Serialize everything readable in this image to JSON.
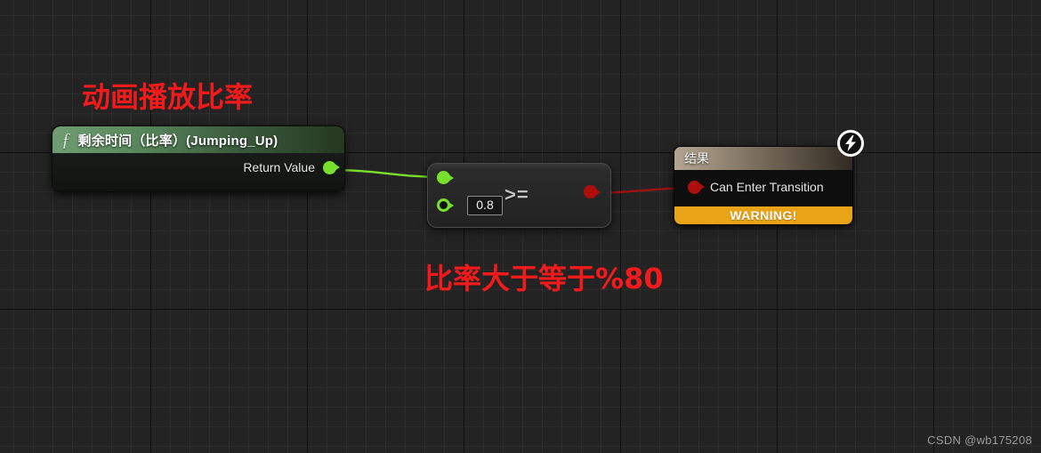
{
  "graph": {
    "title": "Animation Blueprint Transition Rule Graph",
    "background_color": "#232323",
    "grid_minor_color": "#2a2a2a",
    "grid_major_color": "#121212"
  },
  "nodes": {
    "function_node": {
      "icon": "function-f-icon",
      "title": "剩余时间（比率）(Jumping_Up)",
      "header_color": "#5b8a5e",
      "output_pin": {
        "label": "Return Value",
        "type": "float",
        "color": "#77e02a",
        "connected": true
      }
    },
    "compare_node": {
      "operator": ">=",
      "input_a": {
        "name": "a-input-pin",
        "type": "float",
        "color": "#77e02a",
        "connected": true
      },
      "input_b": {
        "name": "b-input-pin",
        "type": "float",
        "color": "#77e02a",
        "connected": false,
        "value": "0.8"
      },
      "output": {
        "name": "result-output-pin",
        "type": "bool",
        "color": "#b00d0d",
        "connected": true
      }
    },
    "result_node": {
      "title": "结果",
      "header_color": "#9b8c79",
      "input_pin": {
        "label": "Can Enter Transition",
        "type": "bool",
        "color": "#b00d0d",
        "connected": true
      },
      "status_banner": {
        "label": "WARNING!",
        "color": "#e8a317"
      },
      "badge": {
        "icon": "lightning-bolt-icon",
        "color": "#ffffff"
      }
    }
  },
  "wires": [
    {
      "name": "float-wire",
      "from": "function_node.output_pin",
      "to": "compare_node.input_a",
      "color": "#77e02a"
    },
    {
      "name": "bool-wire",
      "from": "compare_node.output",
      "to": "result_node.input_pin",
      "color": "#a01010"
    }
  ],
  "annotations": [
    {
      "name": "annotation-play-rate",
      "text": "动画播放比率",
      "color": "#f21a1a"
    },
    {
      "name": "annotation-rate-threshold",
      "text": "比率大于等于%80",
      "color": "#f21a1a"
    }
  ],
  "watermark": {
    "text": "CSDN @wb175208"
  }
}
